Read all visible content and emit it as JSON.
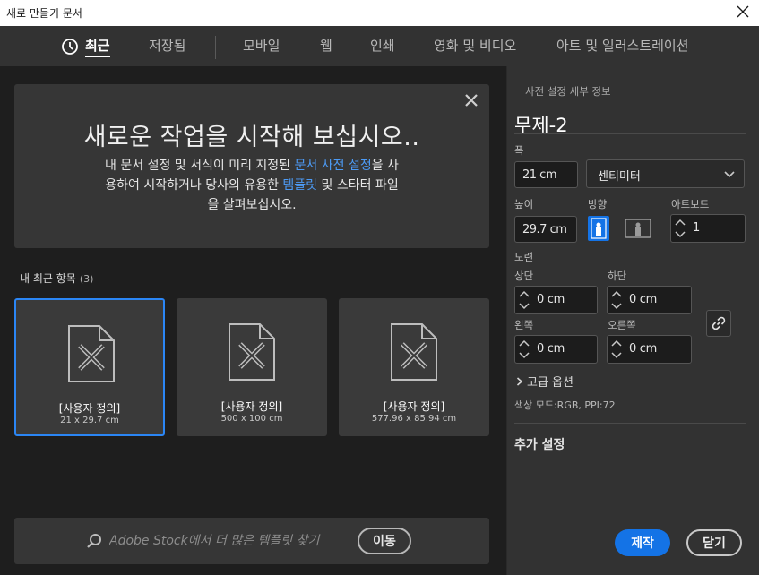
{
  "window": {
    "title": "새로 만들기 문서"
  },
  "nav": {
    "tabs": [
      {
        "label": "최근",
        "active": true
      },
      {
        "label": "저장됨"
      },
      {
        "label": "모바일"
      },
      {
        "label": "웹"
      },
      {
        "label": "인쇄"
      },
      {
        "label": "영화 및 비디오"
      },
      {
        "label": "아트 및 일러스트레이션"
      }
    ]
  },
  "hero": {
    "heading": "새로운 작업을 시작해 보십시오..",
    "p1": "내 문서 설정 및 서식이 미리 지정된 ",
    "link1": "문서 사전 설정",
    "p2": "을 사용하여 시작하거나 당사의 유용한 ",
    "link2": "템플릿",
    "p3": " 및 스타터 파일을 살펴보십시오."
  },
  "recent": {
    "title": "내 최근 항목",
    "count": "(3)",
    "items": [
      {
        "name": "[사용자 정의]",
        "size": "21 x 29.7 cm",
        "selected": true
      },
      {
        "name": "[사용자 정의]",
        "size": "500 x 100 cm"
      },
      {
        "name": "[사용자 정의]",
        "size": "577.96 x 85.94 cm"
      }
    ]
  },
  "stock": {
    "placeholder": "Adobe Stock에서 더 많은 템플릿 찾기",
    "go_label": "이동"
  },
  "preset": {
    "section_title": "사전 설정 세부 정보",
    "doc_name": "무제-2",
    "width_label": "폭",
    "width_value": "21 cm",
    "unit": "센티미터",
    "height_label": "높이",
    "height_value": "29.7 cm",
    "orientation_label": "방향",
    "artboards_label": "아트보드",
    "artboards_value": "1",
    "bleed_label": "도련",
    "top_label": "상단",
    "top_value": "0 cm",
    "bottom_label": "하단",
    "bottom_value": "0 cm",
    "left_label": "왼쪽",
    "left_value": "0 cm",
    "right_label": "오른쪽",
    "right_value": "0 cm",
    "advanced_label": "고급 옵션",
    "color_info": "색상 모드:RGB, PPI:72",
    "more_settings": "추가 설정",
    "create_label": "제작",
    "close_label": "닫기"
  },
  "colors": {
    "accent": "#1473e6",
    "link": "#4d9bf5",
    "selected_border": "#2b86f5"
  }
}
